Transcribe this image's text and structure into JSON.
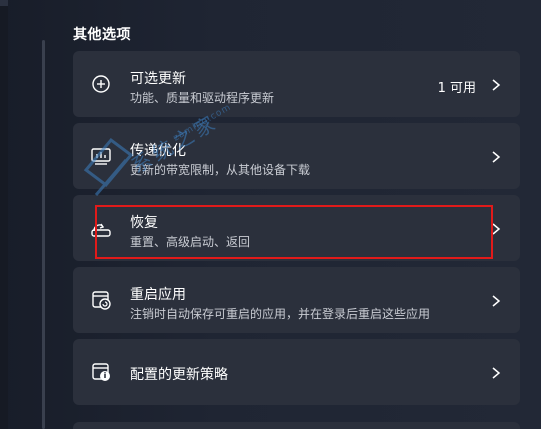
{
  "section": {
    "title": "其他选项"
  },
  "items": [
    {
      "title": "可选更新",
      "subtitle": "功能、质量和驱动程序更新",
      "badge": "1 可用",
      "icon": "plus-circle-icon"
    },
    {
      "title": "传递优化",
      "subtitle": "更新的带宽限制，从其他设备下载",
      "icon": "delivery-optimization-icon"
    },
    {
      "title": "恢复",
      "subtitle": "重置、高级启动、返回",
      "icon": "recovery-icon"
    },
    {
      "title": "重启应用",
      "subtitle": "注销时自动保存可重启的应用，并在登录后重启这些应用",
      "icon": "restart-apps-icon"
    },
    {
      "title": "配置的更新策略",
      "icon": "update-policy-icon"
    }
  ],
  "watermark": {
    "text": "系统之家",
    "url": "zaming.com"
  },
  "colors": {
    "background": "#1f2533",
    "card": "#2b303c",
    "highlight": "#e11a1a",
    "watermark": "#3d7fc0"
  }
}
